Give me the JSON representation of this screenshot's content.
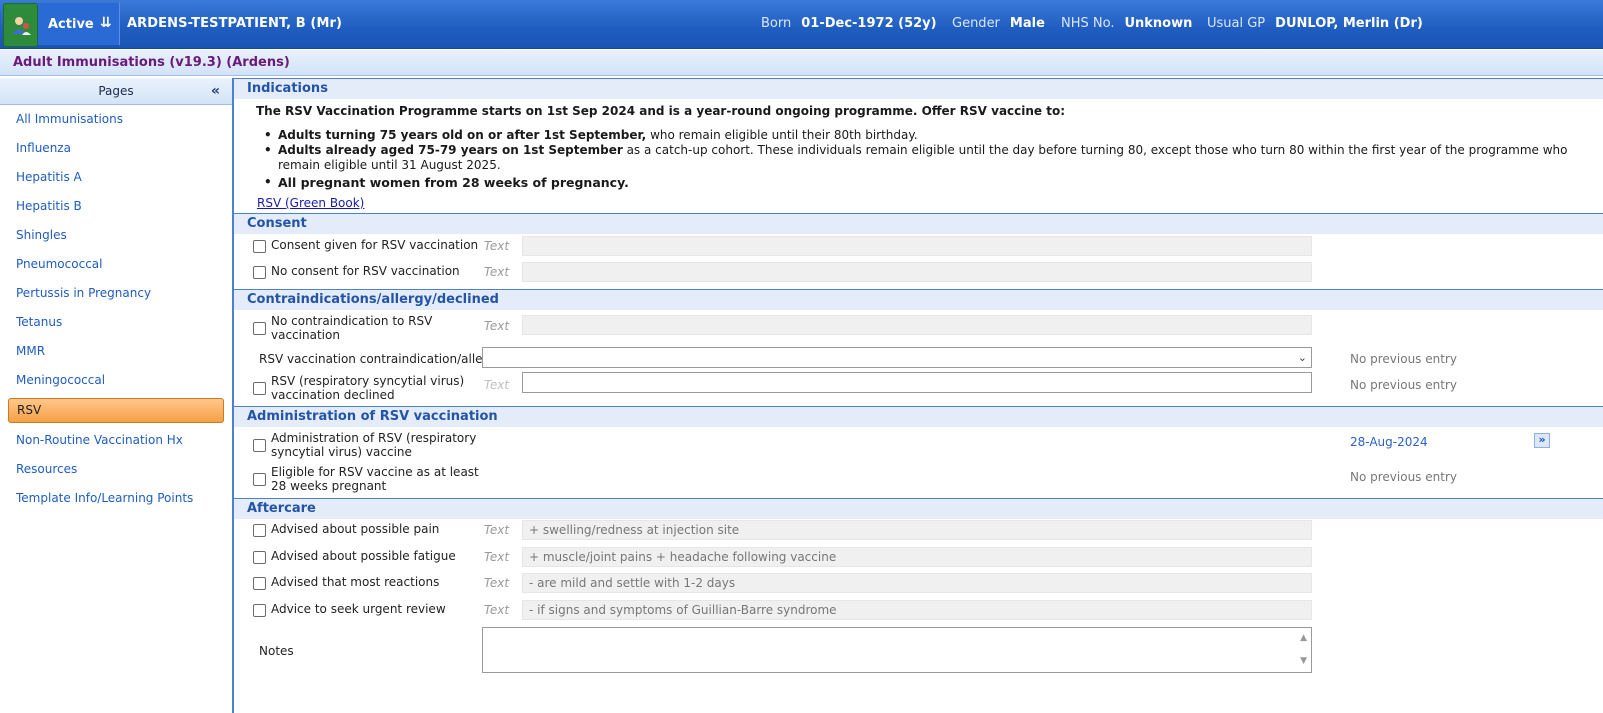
{
  "header": {
    "status": "Active",
    "patient_name": "ARDENS-TESTPATIENT,  B (Mr)",
    "born_label": "Born",
    "born_value": "01-Dec-1972 (52y)",
    "gender_label": "Gender",
    "gender_value": "Male",
    "nhs_label": "NHS No.",
    "nhs_value": "Unknown",
    "gp_label": "Usual GP",
    "gp_value": "DUNLOP, Merlin (Dr)"
  },
  "template_title": "Adult Immunisations (v19.3) (Ardens)",
  "sidebar": {
    "title": "Pages",
    "collapse": "«",
    "items": [
      {
        "label": "All Immunisations"
      },
      {
        "label": "Influenza"
      },
      {
        "label": "Hepatitis A"
      },
      {
        "label": "Hepatitis B"
      },
      {
        "label": "Shingles"
      },
      {
        "label": "Pneumococcal"
      },
      {
        "label": "Pertussis in Pregnancy"
      },
      {
        "label": "Tetanus"
      },
      {
        "label": "MMR"
      },
      {
        "label": "Meningococcal"
      },
      {
        "label": "RSV"
      },
      {
        "label": "Non-Routine Vaccination Hx"
      },
      {
        "label": "Resources"
      },
      {
        "label": "Template Info/Learning Points"
      }
    ],
    "active_index": 10
  },
  "indications": {
    "heading": "Indications",
    "intro": "The RSV Vaccination Programme starts on 1st Sep 2024 and is a year-round ongoing programme. Offer RSV vaccine to:",
    "bullet1_bold": "Adults turning 75 years old on or after 1st September,",
    "bullet1_rest": " who remain eligible until their 80th birthday.",
    "bullet2_bold": "Adults already aged 75-79 years on 1st September",
    "bullet2_rest": " as a catch-up cohort. These individuals remain eligible until the day before turning 80, except those who turn 80 within the first year of the programme who remain eligible until 31 August 2025.",
    "bullet3_bold": "All pregnant women from 28 weeks of pregnancy.",
    "link": "RSV (Green Book)"
  },
  "consent": {
    "heading": "Consent",
    "given_label": "Consent given for RSV vaccination",
    "none_label": "No consent for RSV vaccination",
    "text_placeholder": "Text"
  },
  "contra": {
    "heading": "Contraindications/allergy/declined",
    "no_contra_label": "No contraindication to RSV vaccination",
    "dropdown_label": "RSV vaccination contraindication/allergy",
    "declined_label": "RSV (respiratory syncytial virus) vaccination declined",
    "text_placeholder": "Text",
    "prev1": "No previous entry",
    "prev2": "No previous entry"
  },
  "admin": {
    "heading": "Administration of RSV vaccination",
    "admin_label": "Administration of RSV (respiratory syncytial virus) vaccine",
    "admin_date": "28-Aug-2024",
    "eligible_label": "Eligible for RSV vaccine as at least 28 weeks pregnant",
    "eligible_prev": "No previous entry"
  },
  "aftercare": {
    "heading": "Aftercare",
    "text_placeholder": "Text",
    "rows": [
      {
        "label": "Advised about possible pain",
        "value": "+ swelling/redness at injection site"
      },
      {
        "label": "Advised about possible fatigue",
        "value": "+  muscle/joint pains + headache following vaccine"
      },
      {
        "label": "Advised that most reactions",
        "value": "- are mild and settle with 1-2 days"
      },
      {
        "label": "Advice to seek urgent review",
        "value": "- if signs and symptoms of Guillian-Barre syndrome"
      }
    ],
    "notes_label": "Notes"
  },
  "colors": {
    "header_blue": "#1f5dc0",
    "link_blue": "#1f5cbf",
    "active_orange": "#f5a045",
    "title_purple": "#6b1a7a"
  }
}
